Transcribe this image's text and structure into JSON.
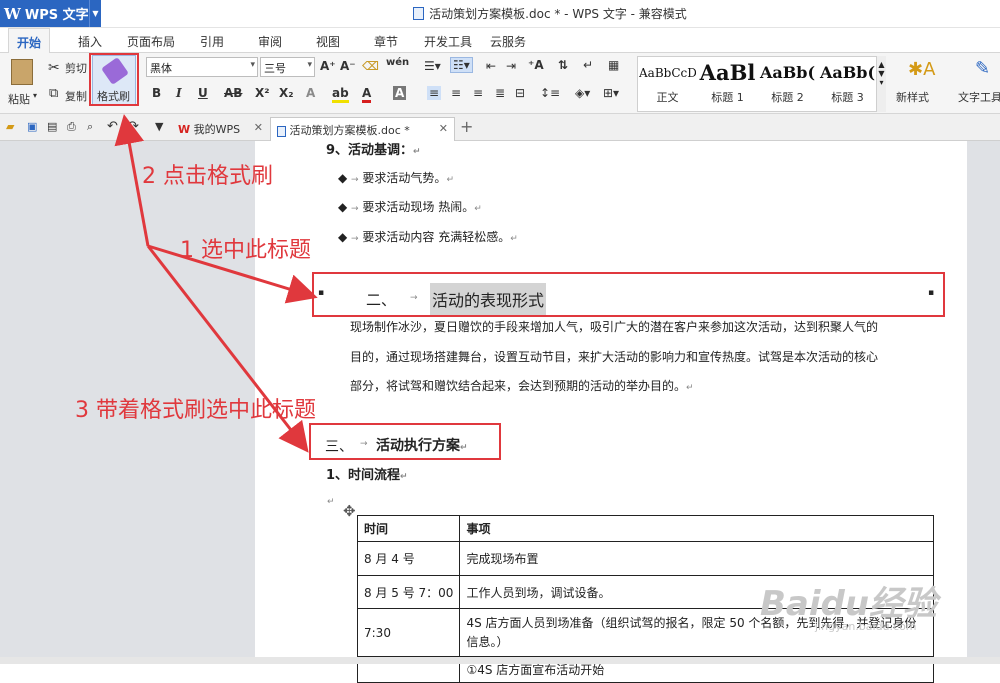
{
  "app": {
    "name": "WPS 文字",
    "window_title": "活动策划方案模板.doc * - WPS 文字 - 兼容模式"
  },
  "menu_tabs": [
    "开始",
    "插入",
    "页面布局",
    "引用",
    "审阅",
    "视图",
    "章节",
    "开发工具",
    "云服务"
  ],
  "ribbon": {
    "paste": "粘贴",
    "cut": "剪切",
    "copy": "复制",
    "format_painter": "格式刷",
    "font_name": "黑体",
    "font_size": "三号",
    "styles": [
      {
        "sample": "AaBbCcD",
        "name": "正文"
      },
      {
        "sample": "AaBl",
        "name": "标题 1"
      },
      {
        "sample": "AaBb(",
        "name": "标题 2"
      },
      {
        "sample": "AaBb(",
        "name": "标题 3"
      }
    ],
    "new_style": "新样式",
    "text_tool": "文字工具"
  },
  "doc_tabs": {
    "home": "我的WPS",
    "current": "活动策划方案模板.doc *"
  },
  "document": {
    "heading9": "9、活动基调：",
    "bullets": [
      "要求活动气势。",
      "要求活动现场 热闹。",
      "要求活动内容 充满轻松感。"
    ],
    "heading2_num": "二、",
    "heading2_text": "活动的表现形式",
    "para": [
      "现场制作冰沙，夏日赠饮的手段来增加人气，吸引广大的潜在客户来参加这次活动，达到积聚人气的",
      "目的，通过现场搭建舞台，设置互动节目，来扩大活动的影响力和宣传热度。试驾是本次活动的核心",
      "部分，将试驾和赠饮结合起来，会达到预期的活动的举办目的。"
    ],
    "heading3_num": "三、",
    "heading3_text": "活动执行方案",
    "sub1": "1、时间流程",
    "table": {
      "headers": [
        "时间",
        "事项"
      ],
      "rows": [
        [
          "8 月 4 号",
          "完成现场布置"
        ],
        [
          "8 月 5 号 7：00",
          "工作人员到场，调试设备。"
        ],
        [
          "7:30",
          "4S 店方面人员到场准备（组织试驾的报名，限定 50 个名额，先到先得，并登记身份信息。）"
        ],
        [
          "",
          "①4S 店方面宣布活动开始"
        ]
      ]
    }
  },
  "annotations": {
    "step1": "1 选中此标题",
    "step2": "2 点击格式刷",
    "step3": "3 带着格式刷选中此标题"
  },
  "watermark": {
    "text": "Baidu经验",
    "url": "jingyan.baidu.com"
  },
  "colors": {
    "accent": "#2b66c1",
    "annotation_red": "#e0383d"
  }
}
